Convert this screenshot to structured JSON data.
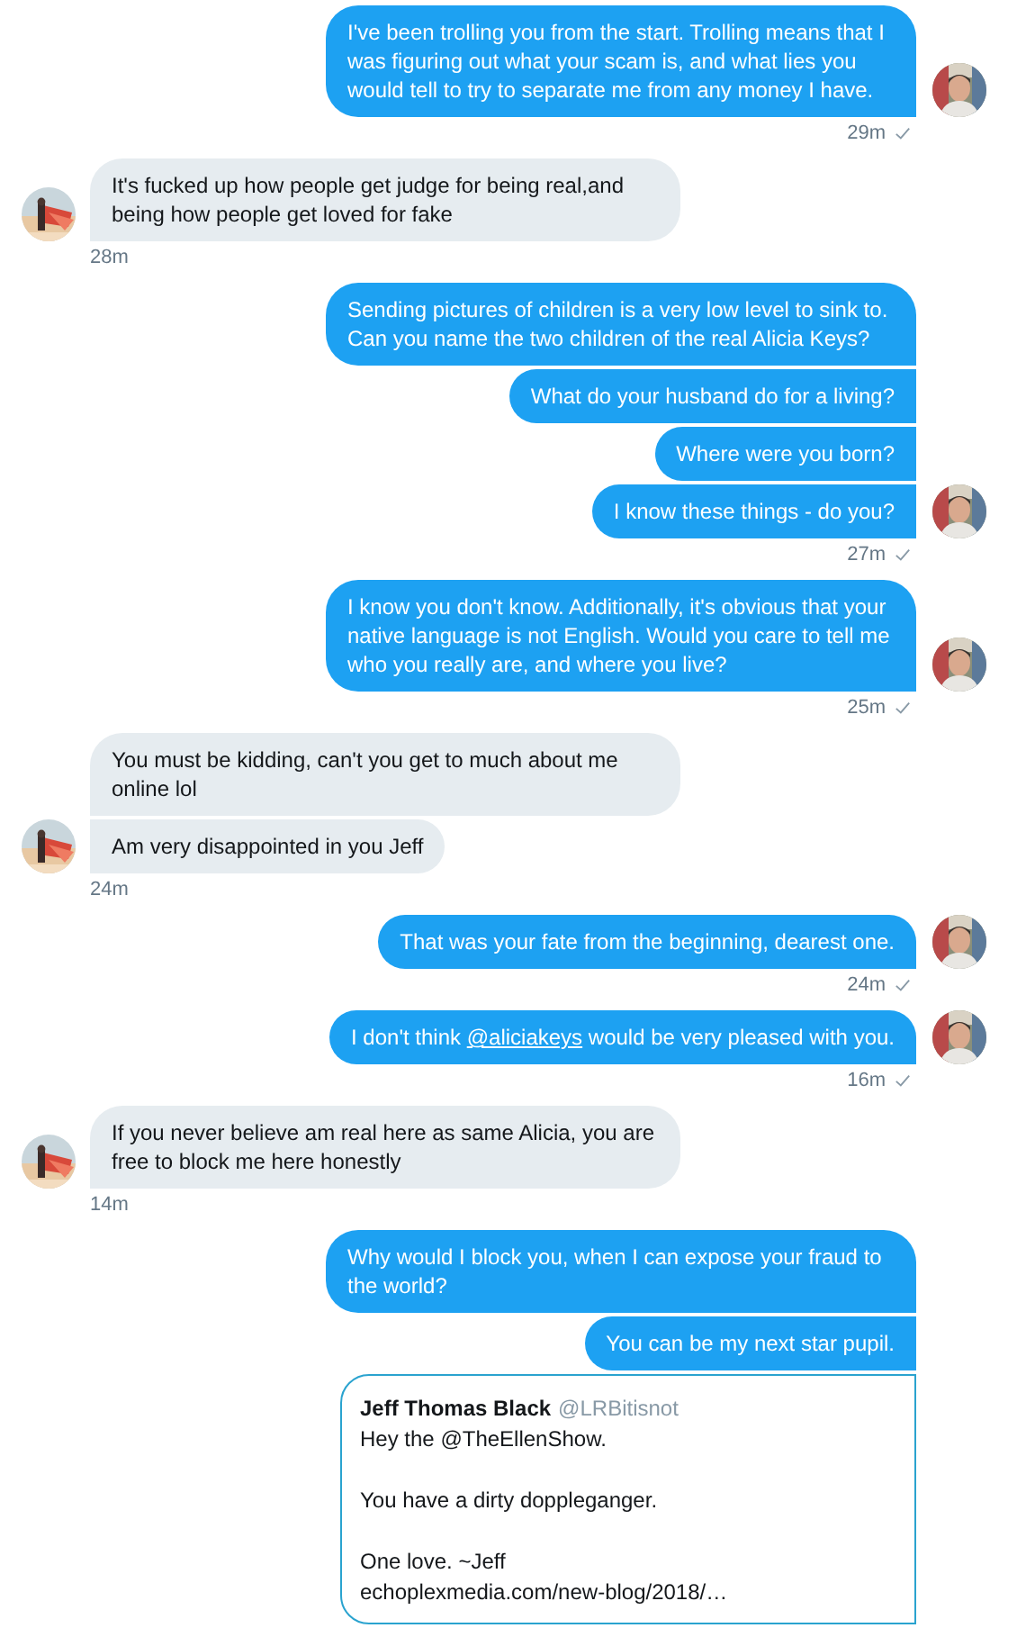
{
  "conversation": [
    {
      "kind": "sent",
      "avatar": true,
      "time": "29m",
      "read": true,
      "messages": [
        {
          "text": "I've been trolling you from the start. Trolling means that I was figuring out what your scam is, and what lies you would tell to try to separate me from any money I have."
        }
      ]
    },
    {
      "kind": "received",
      "avatar": true,
      "time": "28m",
      "messages": [
        {
          "text": "It's fucked up how people get judge for being real,and being how people get loved for fake"
        }
      ]
    },
    {
      "kind": "sent",
      "avatar": true,
      "time": "27m",
      "read": true,
      "messages": [
        {
          "text": "Sending pictures of children is a very low level to sink to. Can you name the two children of the real Alicia Keys?"
        },
        {
          "text": "What do your husband do for a living?"
        },
        {
          "text": "Where were you born?"
        },
        {
          "text": "I know these things - do you?"
        }
      ]
    },
    {
      "kind": "sent",
      "avatar": true,
      "time": "25m",
      "read": true,
      "messages": [
        {
          "text": "I know you don't know. Additionally, it's obvious that your native language is not English. Would you care to tell me who you really are, and where you live?"
        }
      ]
    },
    {
      "kind": "received",
      "avatar": true,
      "time": "24m",
      "messages": [
        {
          "text": "You must be kidding, can't you get to much about me online lol"
        },
        {
          "text": "Am very disappointed in you Jeff"
        }
      ]
    },
    {
      "kind": "sent",
      "avatar": true,
      "time": "24m",
      "read": true,
      "messages": [
        {
          "text": "That was your fate from the beginning, dearest one."
        }
      ]
    },
    {
      "kind": "sent",
      "avatar": true,
      "time": "16m",
      "read": true,
      "messages": [
        {
          "parts": [
            {
              "kind": "text",
              "text": "I don't think "
            },
            {
              "kind": "mention",
              "text": "@aliciakeys"
            },
            {
              "kind": "text",
              "text": " would be very pleased with you."
            }
          ]
        }
      ]
    },
    {
      "kind": "received",
      "avatar": true,
      "time": "14m",
      "messages": [
        {
          "text": "If you never believe am real here as same Alicia, you are free to block me here honestly"
        }
      ]
    },
    {
      "kind": "sent",
      "messages": [
        {
          "text": "Why would I block you, when I can expose your fraud to the world?"
        },
        {
          "text": "You can be my next star pupil."
        }
      ],
      "quoted_tweet": {
        "name": "Jeff Thomas Black",
        "handle": "@LRBitisnot",
        "paragraphs": [
          [
            "Hey the @TheEllenShow."
          ],
          [
            "You have a dirty doppleganger."
          ],
          [
            "One love. ~Jeff",
            "echoplexmedia.com/new-blog/2018/…"
          ]
        ]
      }
    }
  ]
}
